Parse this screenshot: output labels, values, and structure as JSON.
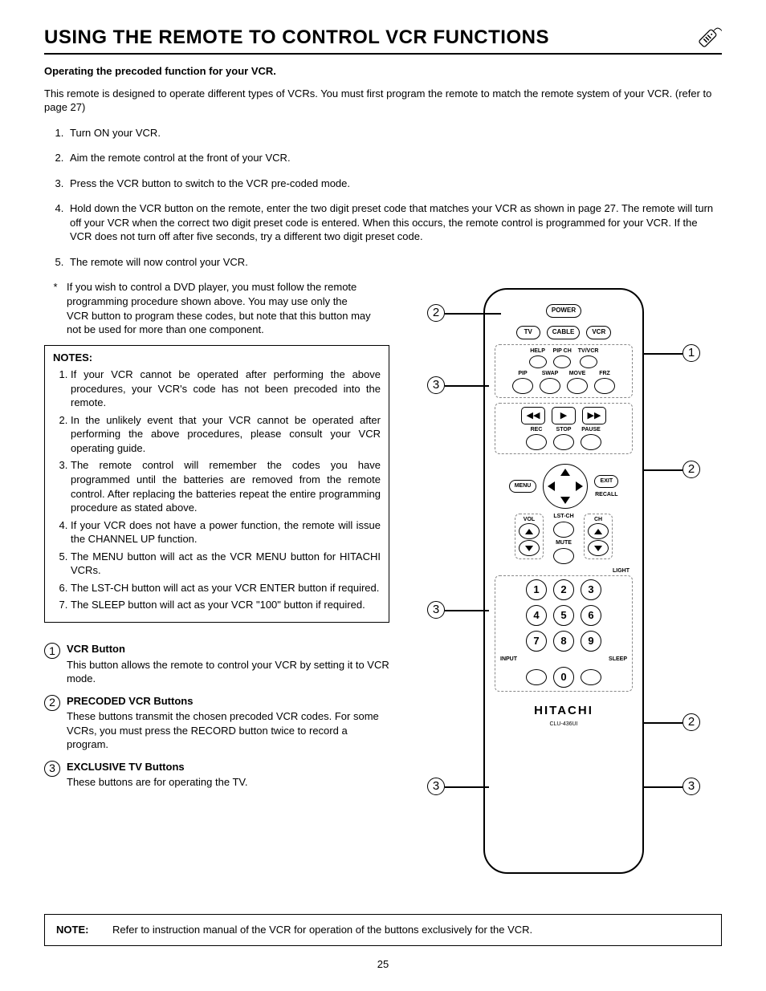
{
  "title": "USING THE REMOTE TO CONTROL VCR FUNCTIONS",
  "intro_bold": "Operating the precoded function for your VCR.",
  "intro_para": "This remote is designed to operate different types of VCRs.  You must first program the remote to match the remote system of your VCR. (refer to page 27)",
  "steps": [
    "Turn ON your VCR.",
    "Aim the remote control at the front of your VCR.",
    "Press the VCR button to switch to the VCR pre-coded mode.",
    "Hold down the VCR button on the remote, enter the two digit preset code that matches your VCR as shown in page 27.  The remote will turn off your VCR when the correct two digit preset code is entered.  When this occurs, the remote control is programmed for your VCR.  If the VCR does not turn off after five seconds, try a different two digit preset code.",
    "The remote will now control your VCR."
  ],
  "star_note": "If you wish to control a DVD player, you must follow the remote programming procedure shown above.  You may use only the VCR button to program these codes, but note that this button may not be used for more than one component.",
  "notes_header": "NOTES:",
  "notes": [
    "If your VCR cannot be operated after performing the above procedures, your VCR's code has not been precoded into the remote.",
    "In the unlikely event that your VCR cannot be operated after performing the above procedures, please consult your VCR operating guide.",
    "The remote control will remember the codes you have programmed until the batteries are removed from the remote control.  After replacing the batteries repeat the entire programming procedure as stated above.",
    "If your VCR does not have a power function, the remote will issue the CHANNEL UP function.",
    "The MENU button will act as the VCR MENU button for HITACHI VCRs.",
    "The LST-CH button will act as your VCR ENTER button if required.",
    "The SLEEP button will act as your VCR \"100\" button if required."
  ],
  "legend": [
    {
      "num": "1",
      "title": "VCR Button",
      "desc": "This button allows the remote to control your VCR by setting it to VCR mode."
    },
    {
      "num": "2",
      "title": "PRECODED VCR Buttons",
      "desc": "These buttons transmit the chosen precoded VCR codes.  For some VCRs, you must press the RECORD button twice to record a program."
    },
    {
      "num": "3",
      "title": "EXCLUSIVE TV Buttons",
      "desc": "These buttons are for operating the TV."
    }
  ],
  "bottom_note_label": "NOTE:",
  "bottom_note_text": "Refer to instruction manual of the VCR for operation of the buttons exclusively for the VCR.",
  "page_number": "25",
  "remote": {
    "power": "POWER",
    "mode": {
      "tv": "TV",
      "cable": "CABLE",
      "vcr": "VCR"
    },
    "row1": {
      "help": "HELP",
      "pipch": "PIP CH",
      "tvvcr": "TV/VCR"
    },
    "row2": {
      "pip": "PIP",
      "swap": "SWAP",
      "move": "MOVE",
      "frz": "FRZ"
    },
    "transport": {
      "rec": "REC",
      "stop": "STOP",
      "pause": "PAUSE"
    },
    "menu": "MENU",
    "exit": "EXIT",
    "recall": "RECALL",
    "vol": "VOL",
    "ch": "CH",
    "lstch": "LST-CH",
    "mute": "MUTE",
    "light": "LIGHT",
    "input": "INPUT",
    "sleep": "SLEEP",
    "keypad": [
      "1",
      "2",
      "3",
      "4",
      "5",
      "6",
      "7",
      "8",
      "9",
      "0"
    ],
    "brand": "HITACHI",
    "model": "CLU-436UI"
  },
  "callouts": {
    "c1": "1",
    "c2": "2",
    "c3": "3"
  }
}
